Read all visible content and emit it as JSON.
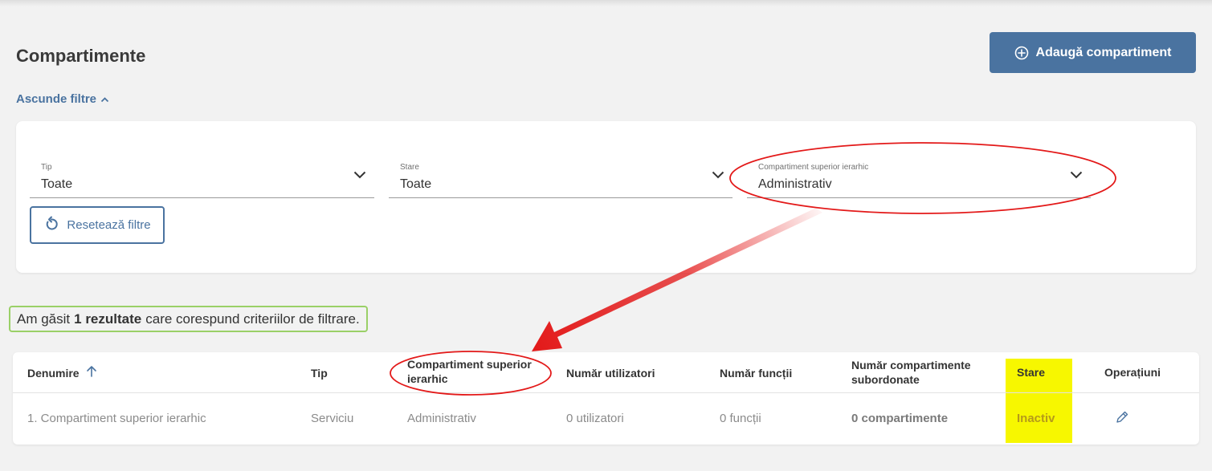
{
  "page": {
    "title": "Compartimente",
    "add_button": "Adaugă compartiment",
    "toggle_filters": "Ascunde filtre"
  },
  "filters": {
    "tip": {
      "label": "Tip",
      "value": "Toate"
    },
    "stare": {
      "label": "Stare",
      "value": "Toate"
    },
    "superior": {
      "label": "Compartiment superior ierarhic",
      "value": "Administrativ"
    },
    "reset_button": "Resetează filtre"
  },
  "results": {
    "prefix": "Am găsit",
    "count": "1 rezultate",
    "suffix": "care corespund criteriilor de filtrare."
  },
  "table": {
    "columns": {
      "denumire": "Denumire",
      "tip": "Tip",
      "superior": "Compartiment superior ierarhic",
      "utilizatori": "Număr utilizatori",
      "functii": "Număr funcții",
      "subordonate": "Număr compartimente subordonate",
      "stare": "Stare",
      "operatiuni": "Operațiuni"
    },
    "rows": [
      {
        "denumire": "1. Compartiment superior ierarhic",
        "tip": "Serviciu",
        "superior": "Administrativ",
        "utilizatori": "0 utilizatori",
        "functii": "0 funcții",
        "subordonate": "0 compartimente",
        "stare": "Inactiv"
      }
    ],
    "sort_icon": "arrow-up-icon",
    "edit_icon": "pencil-icon"
  },
  "annotations": {
    "ellipse_color": "#e31919",
    "arrow_color": "#e31919",
    "result_highlight_color": "#9ad067",
    "stare_highlight_color": "#f7f700"
  }
}
